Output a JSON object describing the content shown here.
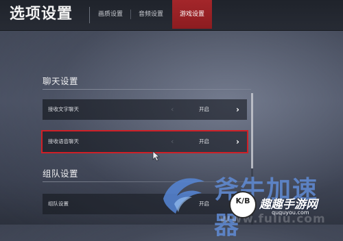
{
  "header": {
    "title": "选项设置",
    "tabs": [
      {
        "label": "画质设置",
        "active": false
      },
      {
        "label": "音频设置",
        "active": false
      },
      {
        "label": "游戏设置",
        "active": true
      }
    ]
  },
  "sections": {
    "chat": {
      "title": "聊天设置",
      "rows": [
        {
          "label": "接收文字聊天",
          "value": "开启",
          "selected": false
        },
        {
          "label": "接收语音聊天",
          "value": "开启",
          "selected": true
        }
      ]
    },
    "team": {
      "title": "组队设置",
      "rows": [
        {
          "label": "组队设置",
          "value": "开启",
          "selected": false
        }
      ]
    }
  },
  "icons": {
    "prev": "‹",
    "next": "›"
  },
  "watermark": {
    "text": "斧牛加速器",
    "badge": "K/B",
    "brand": "趣趣手游网",
    "url": "ququyou.com",
    "url_bg": "www.fuliu.com"
  },
  "colors": {
    "accent_red": "#a3262a",
    "selection_outline": "#d01f26",
    "watermark_blue": "#608cd6"
  }
}
